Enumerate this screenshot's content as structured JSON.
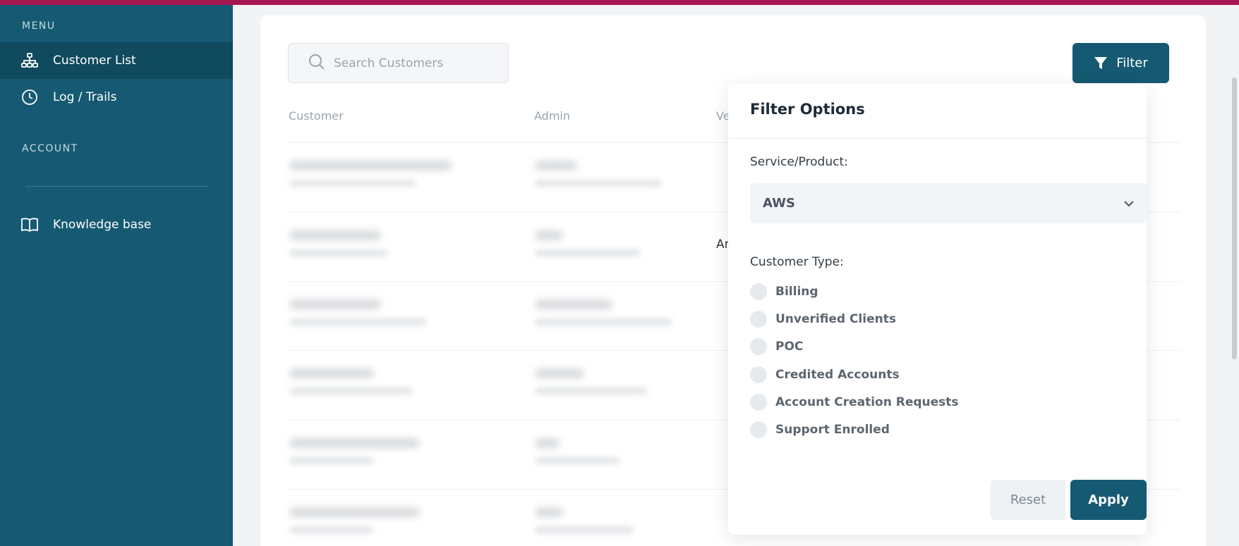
{
  "sidebar": {
    "menu_heading": "MENU",
    "account_heading": "ACCOUNT",
    "items": [
      {
        "label": "Customer List",
        "icon": "sitemap-icon",
        "active": true
      },
      {
        "label": "Log / Trails",
        "icon": "clock-icon",
        "active": false
      },
      {
        "label": "Knowledge base",
        "icon": "book-icon",
        "active": false
      }
    ]
  },
  "search": {
    "placeholder": "Search Customers"
  },
  "table": {
    "headers": [
      "Customer",
      "Admin",
      "Ve"
    ],
    "visible_fragment": "Ar"
  },
  "filter_button": {
    "label": "Filter"
  },
  "filter_panel": {
    "title": "Filter Options",
    "service_label": "Service/Product:",
    "service_value": "AWS",
    "customer_type_label": "Customer Type:",
    "options": [
      "Billing",
      "Unverified Clients",
      "POC",
      "Credited Accounts",
      "Account Creation Requests",
      "Support Enrolled"
    ],
    "reset_label": "Reset",
    "apply_label": "Apply"
  },
  "colors": {
    "brand": "#155a72",
    "accent_bar": "#a5154f"
  }
}
